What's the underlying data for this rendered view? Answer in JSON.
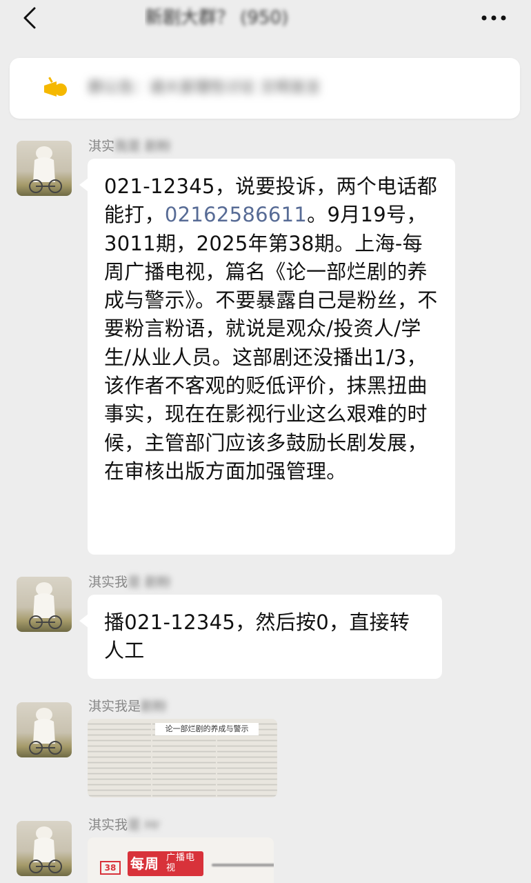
{
  "nav": {
    "back_icon": "chevron-left-icon",
    "title": "新剧大群？ (950)",
    "more_icon": "more-horizontal-icon"
  },
  "notice": {
    "icon": "announcement-icon",
    "text": "群公告：请大家理性讨论 文明发言"
  },
  "messages": [
    {
      "sender_visible": "淇实",
      "sender_blurred": "我是 剧粉",
      "text_before_link": "021-12345，说要投诉，两个电话都能打，",
      "link": "02162586611",
      "text_after_link": "。9月19号，3011期，2025年第38期。上海-每周广播电视，篇名《论一部烂剧的养成与警示》。不要暴露自己是粉丝，不要粉言粉语，就说是观众/投资人/学生/从业人员。这部剧还没播出1/3，该作者不客观的贬低评价，抹黑扭曲事实，现在在影视行业这么艰难的时候，主管部门应该多鼓励长剧发展，在审核出版方面加强管理。"
    },
    {
      "sender_visible": "淇实我",
      "sender_blurred": "是 剧粉",
      "text": "播021-12345，然后按0，直接转人工"
    },
    {
      "sender_visible": "淇实我是",
      "sender_blurred": "剧粉",
      "image_caption": "论一部烂剧的养成与警示"
    },
    {
      "sender_visible": "淇实我",
      "sender_blurred": "是 Hr",
      "magazine_logo": "每周",
      "magazine_sub": "广播电视",
      "magazine_issue": "38"
    }
  ]
}
